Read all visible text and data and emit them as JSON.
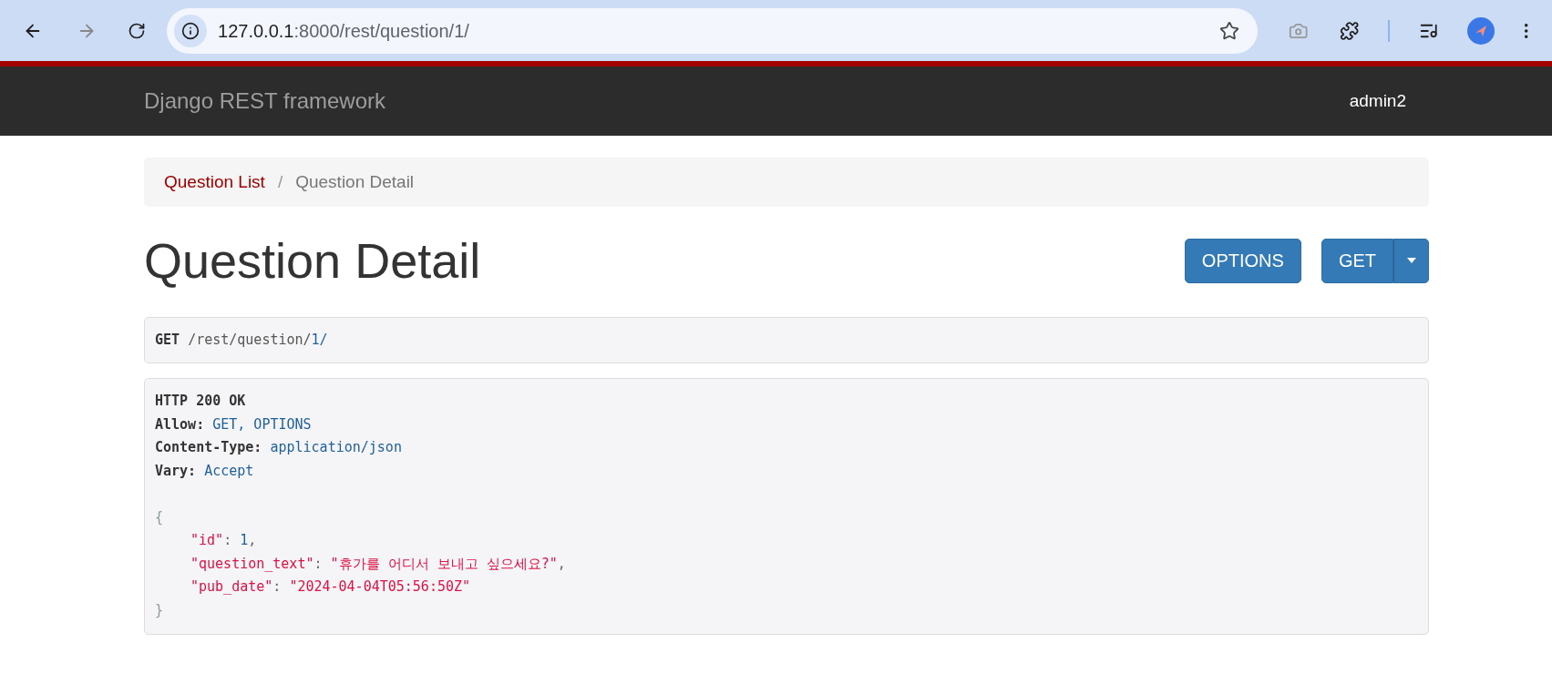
{
  "browser": {
    "url_host": "127.0.0.1",
    "url_rest": ":8000/rest/question/1/",
    "back_disabled": false,
    "forward_disabled": true,
    "screenshot_disabled": true
  },
  "navbar": {
    "brand": "Django REST framework",
    "user": "admin2"
  },
  "breadcrumb": [
    {
      "label": "Question List",
      "selected": false
    },
    {
      "label": "/",
      "kind": "separator"
    },
    {
      "label": "Question Detail",
      "selected": true
    }
  ],
  "page_title": "Question Detail",
  "buttons": [
    {
      "label": "OPTIONS",
      "kind": "plain"
    },
    {
      "label": "GET",
      "kind": "split"
    }
  ],
  "request": {
    "method": "GET",
    "path_prefix": "/rest/question/",
    "path_id": "1/"
  },
  "response": {
    "status": "HTTP 200 OK",
    "headers": [
      {
        "name": "Allow:",
        "value": "GET, OPTIONS"
      },
      {
        "name": "Content-Type:",
        "value": "application/json"
      },
      {
        "name": "Vary:",
        "value": "Accept"
      }
    ],
    "open": "{",
    "fields": [
      {
        "key": "\"id\"",
        "separator": ": ",
        "value": "1",
        "kind": "number",
        "trail": ","
      },
      {
        "key": "\"question_text\"",
        "separator": ": ",
        "value": "\"휴가를 어디서 보내고 싶으세요?\"",
        "kind": "string",
        "trail": ","
      },
      {
        "key": "\"pub_date\"",
        "separator": ": ",
        "value": "\"2024-04-04T05:56:50Z\"",
        "kind": "string"
      }
    ],
    "close": "}"
  }
}
